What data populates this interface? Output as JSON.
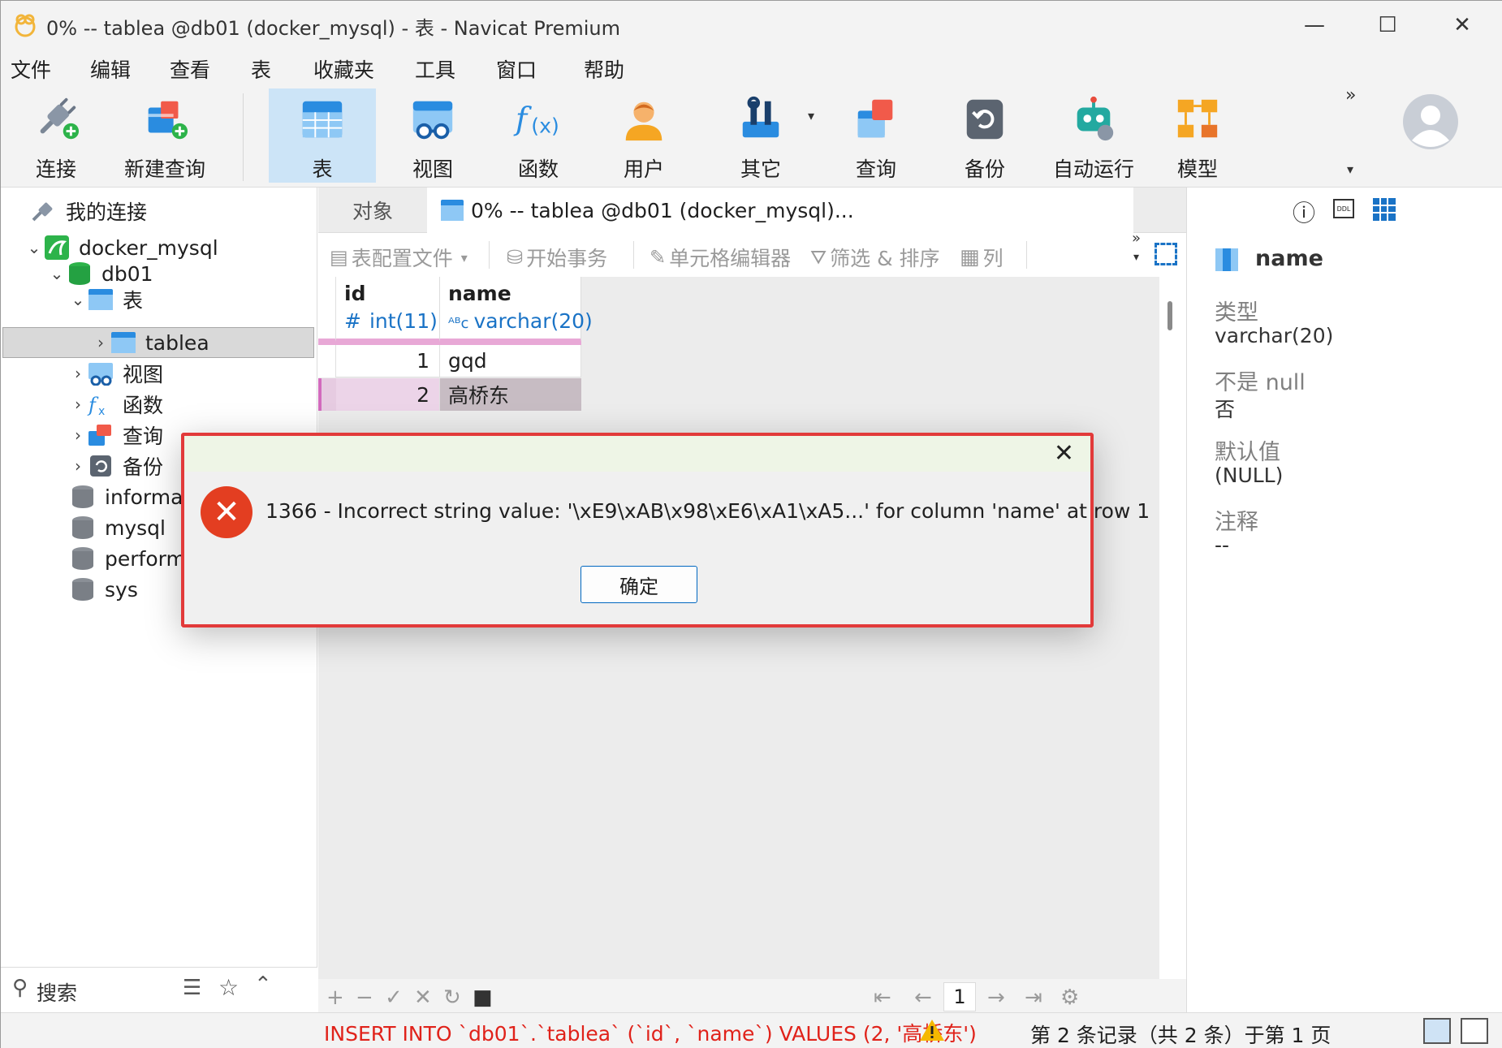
{
  "window": {
    "title": "0% -- tablea @db01 (docker_mysql) - 表 - Navicat Premium",
    "minimize_glyph": "—",
    "maximize_glyph": "☐",
    "close_glyph": "✕"
  },
  "menu": [
    "文件",
    "编辑",
    "查看",
    "表",
    "收藏夹",
    "工具",
    "窗口",
    "帮助"
  ],
  "toolbar": {
    "items": [
      {
        "label": "连接",
        "icon": "plug-add-icon"
      },
      {
        "label": "新建查询",
        "icon": "new-query-icon"
      },
      {
        "label": "表",
        "icon": "table-icon",
        "active": true
      },
      {
        "label": "视图",
        "icon": "view-icon"
      },
      {
        "label": "函数",
        "icon": "function-icon"
      },
      {
        "label": "用户",
        "icon": "user-icon"
      },
      {
        "label": "其它",
        "icon": "tools-icon"
      },
      {
        "label": "查询",
        "icon": "query-icon"
      },
      {
        "label": "备份",
        "icon": "backup-icon"
      },
      {
        "label": "自动运行",
        "icon": "robot-icon"
      },
      {
        "label": "模型",
        "icon": "model-icon"
      }
    ],
    "more_glyph": "»"
  },
  "sidebar": {
    "header": "我的连接",
    "tree": [
      {
        "label": "docker_mysql",
        "level": 0,
        "chev": "⌄"
      },
      {
        "label": "db01",
        "level": 1,
        "chev": "⌄"
      },
      {
        "label": "表",
        "level": 2,
        "chev": "⌄"
      },
      {
        "label": "tablea",
        "level": 3,
        "chev": "›"
      },
      {
        "label": "视图",
        "level": 2,
        "chev": "›"
      },
      {
        "label": "函数",
        "level": 2,
        "chev": "›"
      },
      {
        "label": "查询",
        "level": 2,
        "chev": "›"
      },
      {
        "label": "备份",
        "level": 2,
        "chev": "›"
      },
      {
        "label": "informat",
        "level": 1
      },
      {
        "label": "mysql",
        "level": 1
      },
      {
        "label": "perform",
        "level": 1
      },
      {
        "label": "sys",
        "level": 1
      }
    ],
    "search_placeholder": "搜索"
  },
  "tabs": {
    "objects": "对象",
    "active": "0% -- tablea @db01 (docker_mysql)..."
  },
  "subtoolbar": {
    "profile": "表配置文件",
    "begin_tx": "开始事务",
    "cell_editor": "单元格编辑器",
    "filter_sort": "筛选 & 排序",
    "columns": "列"
  },
  "grid": {
    "columns": [
      {
        "name": "id",
        "type": "int(11)",
        "type_glyph": "#"
      },
      {
        "name": "name",
        "type": "varchar(20)",
        "type_glyph": "ᴬᴮc"
      }
    ],
    "rows": [
      {
        "id": "1",
        "name": "gqd"
      },
      {
        "id": "2",
        "name": "高桥东"
      }
    ]
  },
  "pager": {
    "page": "1"
  },
  "details": {
    "field_name": "name",
    "type_label": "类型",
    "type_value": "varchar(20)",
    "notnull_label": "不是 null",
    "notnull_value": "否",
    "default_label": "默认值",
    "default_value": "(NULL)",
    "comment_label": "注释",
    "comment_value": "--"
  },
  "status": {
    "sql": "INSERT INTO `db01`.`tablea` (`id`, `name`) VALUES (2, '高桥东')",
    "records": "第 2 条记录（共 2 条）于第 1 页"
  },
  "dialog": {
    "message": "1366 - Incorrect string value: '\\xE9\\xAB\\x98\\xE6\\xA1\\xA5...' for column 'name' at row 1",
    "ok_label": "确定",
    "icon_glyph": "✕",
    "close_glyph": "✕"
  },
  "colors": {
    "accent": "#1a73c6",
    "error": "#e33e21",
    "sql_error": "#e0221a",
    "highlight_border": "#e23a3a"
  }
}
